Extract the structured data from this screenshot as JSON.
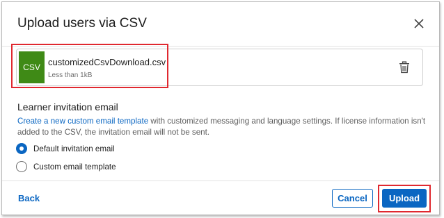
{
  "dialog": {
    "title": "Upload users via CSV"
  },
  "file": {
    "badge": "CSV",
    "name": "customizedCsvDownload.csv",
    "size": "Less than 1kB"
  },
  "invitation": {
    "heading": "Learner invitation email",
    "link_text": "Create a new custom email template",
    "description_rest": " with customized messaging and language settings. If license information isn't added to the CSV, the invitation email will not be sent.",
    "options": [
      {
        "label": "Default invitation email",
        "selected": true
      },
      {
        "label": "Custom email template",
        "selected": false
      }
    ]
  },
  "footer": {
    "back_label": "Back",
    "cancel_label": "Cancel",
    "upload_label": "Upload"
  },
  "colors": {
    "accent": "#0a66c2",
    "csv_badge": "#3f8a16",
    "highlight": "#e0282f"
  }
}
